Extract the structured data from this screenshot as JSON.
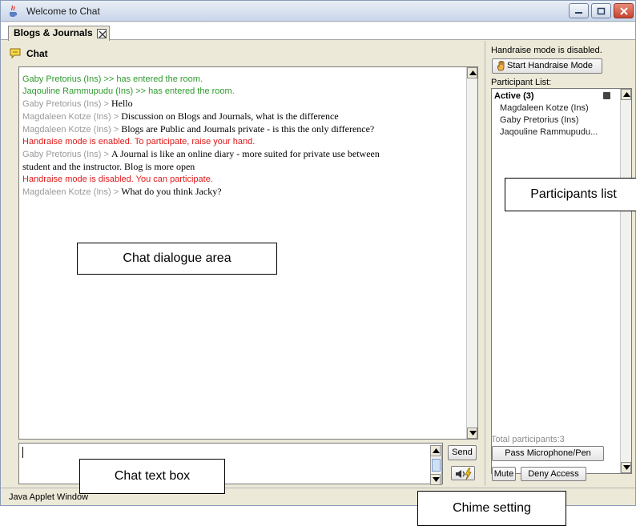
{
  "window": {
    "title": "Welcome to Chat",
    "tab_label": "Blogs & Journals",
    "status_bar": "Java Applet Window"
  },
  "chat": {
    "header_label": "Chat",
    "messages": [
      {
        "style": "green",
        "text": "Gaby Pretorius (Ins) >> has entered the room."
      },
      {
        "style": "green",
        "text": "Jaqouline Rammupudu (Ins) >> has entered the room."
      },
      {
        "style": "normal",
        "who": "Gaby Pretorius (Ins) >",
        "text": "Hello"
      },
      {
        "style": "normal",
        "who": "Magdaleen Kotze (Ins) >",
        "text": "Discussion on Blogs and Journals, what is the difference"
      },
      {
        "style": "normal",
        "who": "Magdaleen Kotze (Ins) >",
        "text": "Blogs are Public and Journals private - is this the only difference?"
      },
      {
        "style": "red",
        "text": "Handraise mode is enabled. To participate, raise your hand."
      },
      {
        "style": "normal",
        "who": "Gaby Pretorius (Ins) >",
        "text": "A Journal is like an online diary - more suited for private use between"
      },
      {
        "style": "cont",
        "text": "student and the instructor.  Blog is more open"
      },
      {
        "style": "red",
        "text": "Handraise mode is disabled. You can participate."
      },
      {
        "style": "normal",
        "who": "Magdaleen Kotze (Ins) >",
        "text": "What do you think Jacky?"
      }
    ],
    "input_value": "",
    "send_label": "Send"
  },
  "right_panel": {
    "handraise_status": "Handraise mode is disabled.",
    "handraise_button": "Start Handraise Mode",
    "participant_list_label": "Participant List:",
    "active_header": "Active (3)",
    "participants": [
      "Magdaleen Kotze (Ins)",
      "Gaby Pretorius (Ins)",
      "Jaqouline Rammupudu..."
    ],
    "total_participants": "Total participants:3",
    "pass_button": "Pass Microphone/Pen",
    "mute_button": "Mute",
    "deny_button": "Deny Access"
  },
  "annotations": {
    "chat_area": "Chat dialogue area",
    "participants": "Participants list",
    "text_box": "Chat text box",
    "chime": "Chime setting"
  },
  "icons": {
    "app": "java-cup-icon",
    "chat": "speech-bubble-icon",
    "hand": "raised-hand-icon",
    "chime": "speaker-chime-icon"
  },
  "colors": {
    "join_message": "#2d9a2d",
    "system_message": "#e01818",
    "sender_name": "#9a9a9a"
  }
}
